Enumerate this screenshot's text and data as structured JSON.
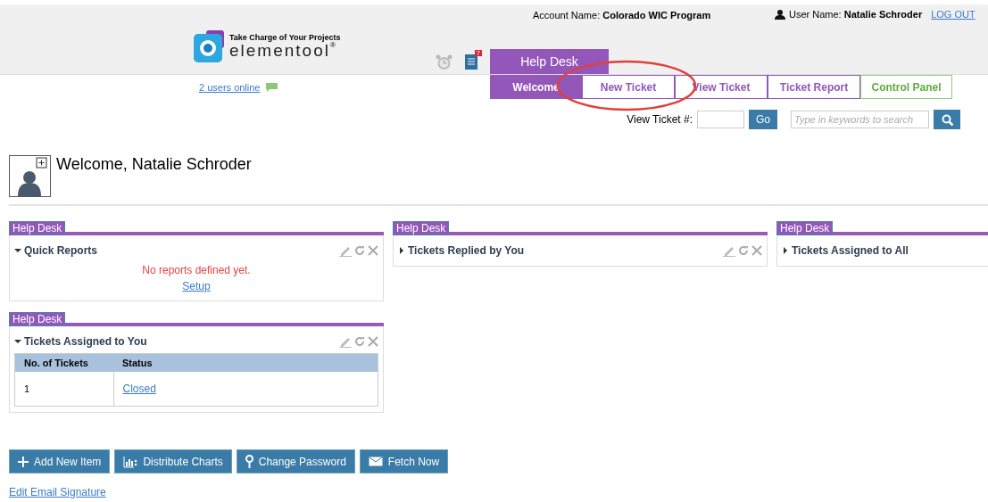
{
  "header": {
    "account_label": "Account Name:",
    "account_name": "Colorado WIC Program",
    "user_label": "User Name:",
    "user_name": "Natalie Schroder",
    "logout": "LOG OUT",
    "logo_tagline": "Take Charge of Your Projects",
    "logo_name": "elementool",
    "logo_mark": "®",
    "notes_badge": "7",
    "module_tab": "Help Desk"
  },
  "users_online": "2 users online",
  "tabs": [
    {
      "label": "Welcome",
      "selected": true,
      "kind": "normal"
    },
    {
      "label": "New Ticket",
      "selected": false,
      "kind": "normal"
    },
    {
      "label": "View Ticket",
      "selected": false,
      "kind": "normal"
    },
    {
      "label": "Ticket Report",
      "selected": false,
      "kind": "normal"
    },
    {
      "label": "Control Panel",
      "selected": false,
      "kind": "admin"
    }
  ],
  "search": {
    "view_ticket_label": "View Ticket #:",
    "go": "Go",
    "placeholder": "Type in keywords to search"
  },
  "welcome": "Welcome, Natalie Schroder",
  "columns": [
    [
      {
        "tag": "Help Desk",
        "title": "Quick Reports",
        "expanded": true,
        "kind": "message",
        "message": "No reports defined yet.",
        "link": "Setup"
      },
      {
        "tag": "Help Desk",
        "title": "Tickets Assigned to You",
        "expanded": true,
        "kind": "table",
        "columns": [
          "No. of Tickets",
          "Status"
        ],
        "rows": [
          [
            "1",
            "Closed"
          ]
        ]
      }
    ],
    [
      {
        "tag": "Help Desk",
        "title": "Tickets Replied by You",
        "expanded": false
      }
    ],
    [
      {
        "tag": "Help Desk",
        "title": "Tickets Assigned to All",
        "expanded": false
      }
    ]
  ],
  "actions": [
    {
      "label": "Add New Item"
    },
    {
      "label": "Distribute Charts"
    },
    {
      "label": "Change Password"
    },
    {
      "label": "Fetch Now"
    }
  ],
  "footer_link": "Edit Email Signature"
}
